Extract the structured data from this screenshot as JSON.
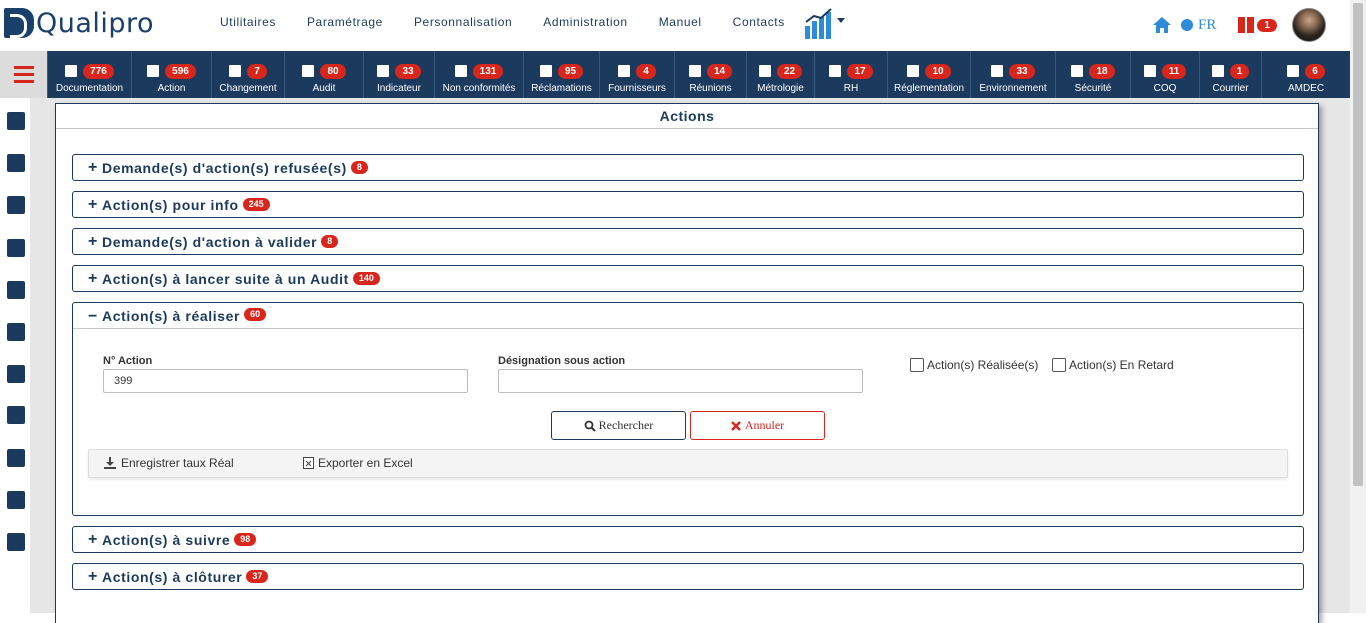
{
  "brand": {
    "logo_text": "Qualipro"
  },
  "topnav": [
    "Utilitaires",
    "Paramétrage",
    "Personnalisation",
    "Administration",
    "Manuel",
    "Contacts"
  ],
  "top_right": {
    "lang": "FR",
    "notif_count": "1"
  },
  "modules": [
    {
      "label": "Documentation",
      "count": "776",
      "icon": "document-icon"
    },
    {
      "label": "Action",
      "count": "596",
      "icon": "server-icon"
    },
    {
      "label": "Changement",
      "count": "7",
      "icon": "gear-icon"
    },
    {
      "label": "Audit",
      "count": "80",
      "icon": "check-square-icon"
    },
    {
      "label": "Indicateur",
      "count": "33",
      "icon": "area-chart-icon"
    },
    {
      "label": "Non conformités",
      "count": "131",
      "icon": "thumbs-down-icon"
    },
    {
      "label": "Réclamations",
      "count": "95",
      "icon": "comment-icon"
    },
    {
      "label": "Fournisseurs",
      "count": "4",
      "icon": "truck-icon"
    },
    {
      "label": "Réunions",
      "count": "14",
      "icon": "globe-icon"
    },
    {
      "label": "Métrologie",
      "count": "22",
      "icon": "list-icon"
    },
    {
      "label": "RH",
      "count": "17",
      "icon": "user-icon"
    },
    {
      "label": "Réglementation",
      "count": "10",
      "icon": "balance-icon"
    },
    {
      "label": "Environnement",
      "count": "33",
      "icon": "tree-icon"
    },
    {
      "label": "Sécurité",
      "count": "18",
      "icon": "medkit-icon"
    },
    {
      "label": "COQ",
      "count": "11",
      "icon": "wrench-icon"
    },
    {
      "label": "Courrier",
      "count": "1",
      "icon": "wrench-icon"
    },
    {
      "label": "AMDEC",
      "count": "6",
      "icon": "wrench-icon"
    }
  ],
  "panel": {
    "title": "Actions"
  },
  "accordions": [
    {
      "sign": "+",
      "title": "Demande(s) d'action(s) refusée(s)",
      "count": "8"
    },
    {
      "sign": "+",
      "title": "Action(s) pour info",
      "count": "245"
    },
    {
      "sign": "+",
      "title": "Demande(s) d'action à valider",
      "count": "8"
    },
    {
      "sign": "+",
      "title": "Action(s) à lancer suite à un Audit",
      "count": "140"
    },
    {
      "sign": "−",
      "title": "Action(s) à réaliser",
      "count": "60"
    },
    {
      "sign": "+",
      "title": "Action(s) à suivre",
      "count": "98"
    },
    {
      "sign": "+",
      "title": "Action(s) à clôturer",
      "count": "37"
    }
  ],
  "form": {
    "num_label": "N° Action",
    "num_value": "399",
    "designation_label": "Désignation sous action",
    "designation_value": "",
    "chk_realisees": "Action(s) Réalisée(s)",
    "chk_retard": "Action(s) En Retard",
    "search_btn": "Rechercher",
    "cancel_btn": "Annuler"
  },
  "toolbar": {
    "save_rate": "Enregistrer taux Réal",
    "export_excel": "Exporter en Excel"
  },
  "colors": {
    "navy": "#1c3a5e",
    "red": "#d9261c",
    "blue": "#2d8bd8"
  }
}
